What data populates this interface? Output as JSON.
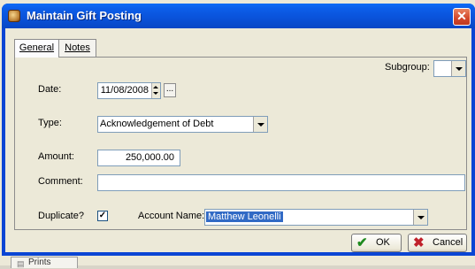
{
  "window": {
    "title": "Maintain Gift Posting",
    "close_glyph": "✕"
  },
  "tabs": [
    {
      "label": "General",
      "active": true
    },
    {
      "label": "Notes",
      "active": false
    }
  ],
  "form": {
    "subgroup": {
      "label": "Subgroup:",
      "value": ""
    },
    "date": {
      "label": "Date:",
      "value": "11/08/2008",
      "picker_label": "..."
    },
    "type": {
      "label": "Type:",
      "value": "Acknowledgement of Debt"
    },
    "amount": {
      "label": "Amount:",
      "value": "250,000.00"
    },
    "comment": {
      "label": "Comment:",
      "value": ""
    },
    "duplicate": {
      "label": "Duplicate?",
      "checked": true,
      "check_glyph": "✓"
    },
    "account_name": {
      "label": "Account Name:",
      "value": "Matthew Leonelli"
    }
  },
  "buttons": {
    "ok": {
      "label": "OK",
      "icon": "check-icon",
      "glyph": "✔",
      "color": "#1f8a1f"
    },
    "cancel": {
      "label": "Cancel",
      "icon": "x-icon",
      "glyph": "✖",
      "color": "#c0202a"
    }
  },
  "background": {
    "tab_label": "Prints"
  }
}
